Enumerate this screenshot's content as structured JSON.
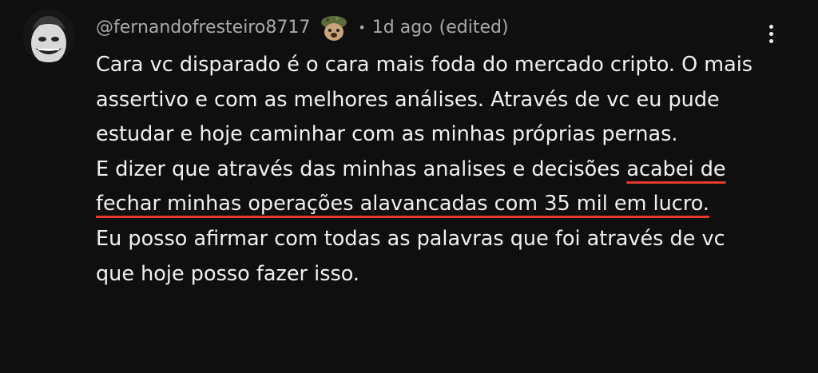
{
  "comment": {
    "author": "@fernandofresteiro8717",
    "separator": "•",
    "timestamp": "1d ago",
    "edited": "(edited)",
    "more_icon": "vertical-ellipsis-icon",
    "avatar_icon": "joker-avatar",
    "badge_icon": "member-badge-icon",
    "text": {
      "para1": "Cara vc disparado é o cara mais foda do mercado cripto. O mais assertivo e com as melhores análises. Através de vc eu pude estudar e hoje caminhar com as minhas próprias pernas.",
      "para2_before": "E dizer que através das minhas analises e decisões ",
      "para2_highlight": "acabei de fechar minhas operações alavancadas com 35 mil em lucro.",
      "para3": "Eu posso afirmar com todas as palavras que foi através de vc que hoje posso fazer isso."
    },
    "underline_color": "#e63a2e"
  }
}
